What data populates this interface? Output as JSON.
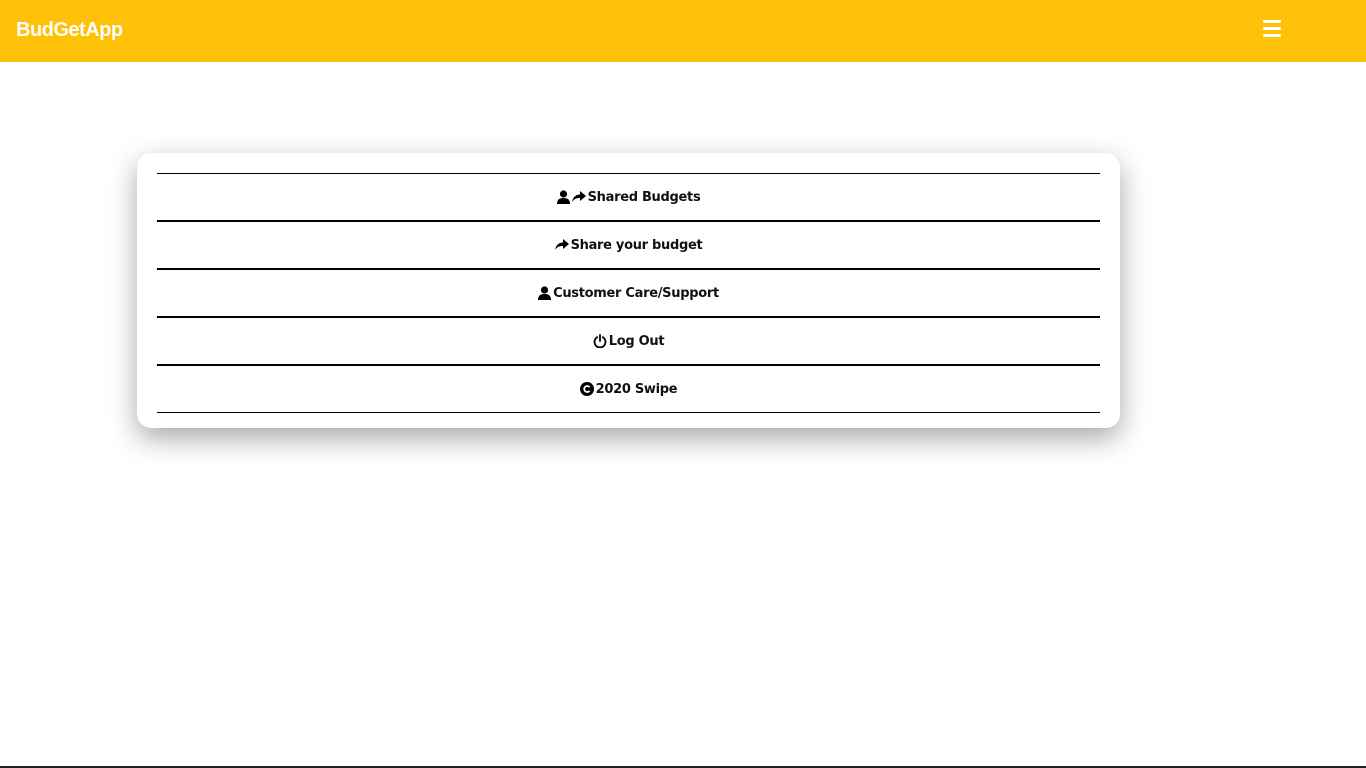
{
  "navbar": {
    "brand": "BudGetApp",
    "background_color": "#ffc107",
    "menu_icon": "hamburger-menu-icon"
  },
  "menu": {
    "items": [
      {
        "label": "Shared Budgets",
        "icons": [
          "user-icon",
          "share-arrow-icon"
        ]
      },
      {
        "label": "Share your budget",
        "icons": [
          "share-arrow-icon"
        ]
      },
      {
        "label": "Customer Care/Support",
        "icons": [
          "user-icon"
        ]
      },
      {
        "label": "Log Out",
        "icons": [
          "power-icon"
        ]
      },
      {
        "label": "2020 Swipe",
        "icons": [
          "copyright-icon"
        ]
      }
    ]
  }
}
